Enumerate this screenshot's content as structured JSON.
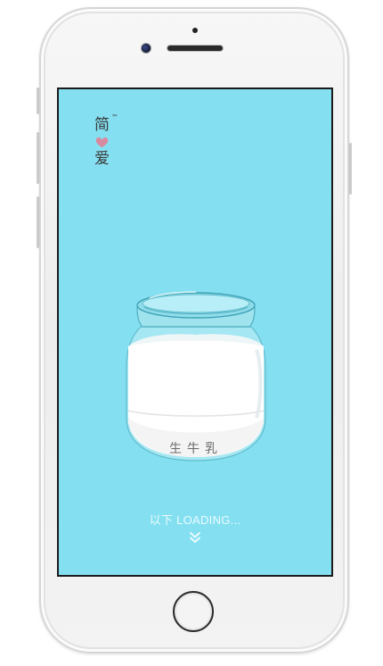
{
  "app": {
    "brand": {
      "top_char": "简",
      "bottom_char": "爱",
      "tm": "™",
      "heart_icon": "heart-icon",
      "heart_color": "#d98aa0"
    },
    "product": {
      "label": "生牛乳"
    },
    "loading": {
      "text": "以下 LOADING...",
      "icon": "double-chevron-down-icon"
    },
    "colors": {
      "screen_background": "#84e0f1",
      "text_light": "#eafaff"
    }
  }
}
